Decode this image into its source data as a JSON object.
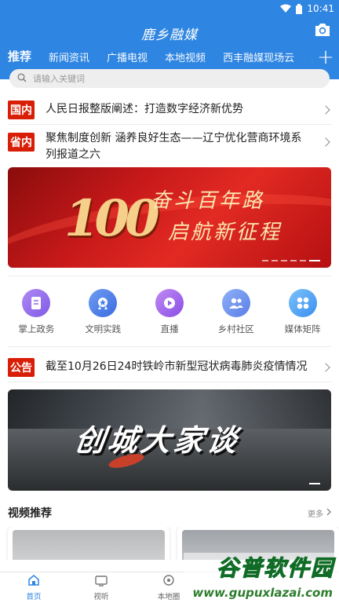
{
  "status": {
    "time": "10:41"
  },
  "header": {
    "logo": "鹿乡融媒"
  },
  "tabs": [
    "推荐",
    "新闻资讯",
    "广播电视",
    "本地视频",
    "西丰融媒现场云",
    "直"
  ],
  "search": {
    "placeholder": "请输入关键词"
  },
  "news": [
    {
      "badge": "国内",
      "text": "人民日报整版阐述：打造数字经济新优势"
    },
    {
      "badge": "省内",
      "text": "聚焦制度创新 涵养良好生态——辽宁优化营商环境系列报道之六"
    }
  ],
  "banner1": {
    "number": "100",
    "line1": "奋斗百年路",
    "line2": "启航新征程"
  },
  "grid": [
    {
      "label": "掌上政务",
      "icon": "document-icon",
      "color": "#8b6ee8"
    },
    {
      "label": "文明实践",
      "icon": "medal-icon",
      "color": "#4a7ee8"
    },
    {
      "label": "直播",
      "icon": "play-icon",
      "color": "#9a5de8"
    },
    {
      "label": "乡村社区",
      "icon": "people-icon",
      "color": "#6a8ef0"
    },
    {
      "label": "媒体矩阵",
      "icon": "grid-icon",
      "color": "#4da2f5"
    }
  ],
  "notice": {
    "badge": "公告",
    "text": "截至10月26日24时铁岭市新型冠状病毒肺炎疫情情况"
  },
  "banner2": {
    "text": "创城大家谈"
  },
  "section": {
    "title": "视频推荐",
    "more": "更多"
  },
  "bottom_tabs": [
    {
      "label": "首页",
      "icon": "home-icon"
    },
    {
      "label": "视听",
      "icon": "tv-icon"
    },
    {
      "label": "本地圈",
      "icon": "circle-icon"
    }
  ],
  "watermark": {
    "line1": "谷普软件园",
    "line2": "www.gupuxlazai.com"
  }
}
